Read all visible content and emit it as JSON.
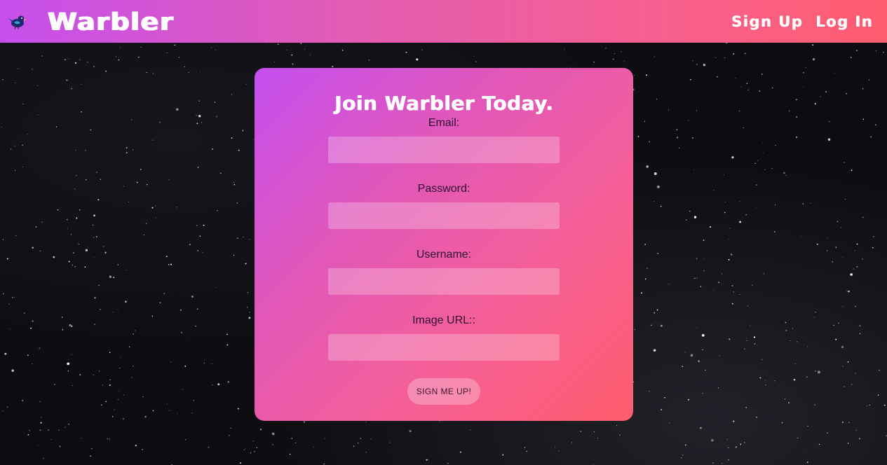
{
  "navbar": {
    "logo_icon": "warbler-bird-icon",
    "brand": "Warbler",
    "links": [
      {
        "label": "Sign Up"
      },
      {
        "label": "Log In"
      }
    ],
    "gradient": [
      "#c64fec",
      "#ff5e6f"
    ]
  },
  "form": {
    "title": "Join Warbler Today.",
    "fields": [
      {
        "label": "Email:",
        "value": "",
        "type": "text"
      },
      {
        "label": "Password:",
        "value": "",
        "type": "password"
      },
      {
        "label": "Username:",
        "value": "",
        "type": "text"
      },
      {
        "label": "Image URL::",
        "value": "",
        "type": "text"
      }
    ],
    "submit_label": "SIGN ME UP!",
    "gradient": [
      "#c44ff0",
      "#ff5e6c"
    ]
  },
  "background": {
    "style": "starfield",
    "color": "#0d0d11"
  }
}
